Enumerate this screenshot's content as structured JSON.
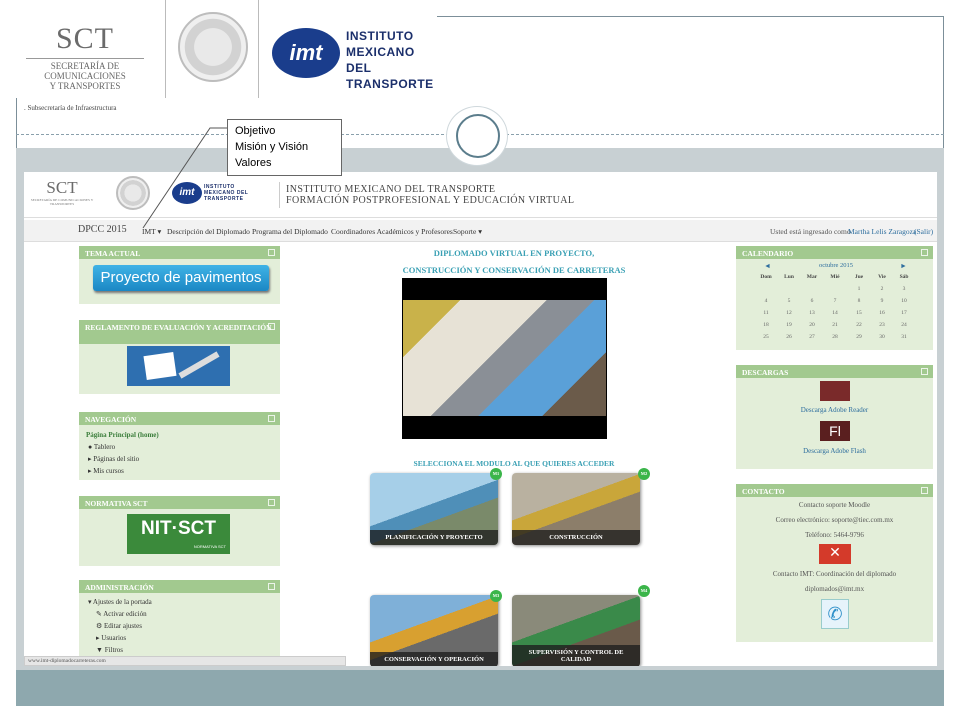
{
  "slide": {
    "subsecretaria": ". Subsecretaría de Infraestructura"
  },
  "logos": {
    "sct_abbr": "SCT",
    "sct_name_lines": [
      "SECRETARÍA DE",
      "COMUNICACIONES",
      "Y TRANSPORTES"
    ],
    "imt_mark": "imt",
    "imt_lines": [
      "INSTITUTO",
      "MEXICANO DEL",
      "TRANSPORTE"
    ]
  },
  "callout": {
    "items": [
      "Objetivo",
      "Misión y Visión",
      "Valores"
    ]
  },
  "moodle": {
    "header": {
      "sct_abbr": "SCT",
      "sct_name": "SECRETARÍA DE COMUNICACIONES Y TRANSPORTES",
      "imt_mark": "imt",
      "imt_name": "INSTITUTO MEXICANO DEL TRANSPORTE",
      "title1": "INSTITUTO MEXICANO DEL TRANSPORTE",
      "title2": "FORMACIÓN POSTPROFESIONAL Y EDUCACIÓN VIRTUAL"
    },
    "nav": {
      "brand": "DPCC 2015",
      "items": [
        "IMT ▾",
        "Descripción del Diplomado",
        "Programa del Diplomado",
        "Coordinadores Académicos y Profesores",
        "Soporte ▾"
      ],
      "user_prefix": "Usted está ingresado como",
      "user_name": "Martha Lelis Zaragoza",
      "logout": "(Salir)"
    },
    "left": {
      "tema": {
        "title": "TEMA ACTUAL",
        "button": "Proyecto de pavimentos"
      },
      "reglamento": {
        "title": "REGLAMENTO DE EVALUACIÓN Y ACREDITACIÓN"
      },
      "navegacion": {
        "title": "NAVEGACIÓN",
        "home": "Página Principal (home)",
        "items": [
          "Tablero",
          "Páginas del sitio",
          "Mis cursos"
        ]
      },
      "normativa": {
        "title": "NORMATIVA SCT",
        "logo_text": "NIT·SCT",
        "logo_sub": "NORMATIVA SCT"
      },
      "admin": {
        "title": "ADMINISTRACIÓN",
        "section": "Ajustes de la portada",
        "items": [
          "Activar edición",
          "Editar ajustes",
          "Usuarios",
          "Filtros"
        ]
      }
    },
    "center": {
      "title_line1": "DIPLOMADO VIRTUAL EN PROYECTO,",
      "title_line2": "CONSTRUCCIÓN Y CONSERVACIÓN DE CARRETERAS",
      "select_text": "SELECCIONA EL MODULO AL QUE QUIERES ACCEDER",
      "modules": [
        {
          "badge": "M1",
          "caption": "PLANIFICACIÓN Y PROYECTO"
        },
        {
          "badge": "M2",
          "caption": "CONSTRUCCIÓN"
        },
        {
          "badge": "M3",
          "caption": "CONSERVACIÓN Y OPERACIÓN"
        },
        {
          "badge": "M4",
          "caption": "SUPERVISIÓN Y CONTROL DE CALIDAD"
        }
      ]
    },
    "right": {
      "calendario": {
        "title": "CALENDARIO",
        "prev": "◄",
        "next": "►",
        "month": "octubre 2015",
        "days": [
          "Dom",
          "Lun",
          "Mar",
          "Mié",
          "Jue",
          "Vie",
          "Sáb"
        ],
        "weeks": [
          [
            "",
            "",
            "",
            "",
            "1",
            "2",
            "3"
          ],
          [
            "4",
            "5",
            "6",
            "7",
            "8",
            "9",
            "10"
          ],
          [
            "11",
            "12",
            "13",
            "14",
            "15",
            "16",
            "17"
          ],
          [
            "18",
            "19",
            "20",
            "21",
            "22",
            "23",
            "24"
          ],
          [
            "25",
            "26",
            "27",
            "28",
            "29",
            "30",
            "31"
          ]
        ]
      },
      "descargas": {
        "title": "DESCARGAS",
        "reader": "Descarga Adobe Reader",
        "flash_icon": "Fl",
        "flash": "Descarga  Adobe Flash"
      },
      "contacto": {
        "title": "CONTACTO",
        "soporte": "Contacto soporte Moodle",
        "correo": "Correo electrónico: soporte@tiec.com.mx",
        "telefono": "Teléfono:  5464-9796",
        "imt": "Contacto IMT:  Coordinación del diplomado",
        "email": "diplomados@imt.mx"
      }
    },
    "status_url": "www.imt-diplomadocarreteras.com"
  },
  "colors": {
    "block_header": "#a2c98f",
    "block_body": "#e3eed9",
    "title_teal": "#3aa0b4",
    "frame": "#7c8f99"
  }
}
